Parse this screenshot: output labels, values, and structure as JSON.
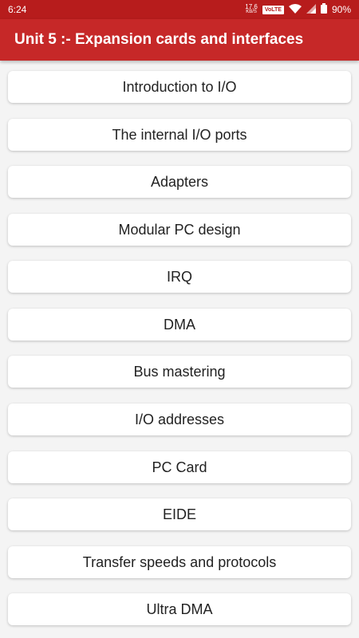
{
  "status_bar": {
    "time": "6:24",
    "net_speed_value": "17.6",
    "net_speed_unit": "KB/S",
    "volte": "VoLTE",
    "battery": "90%"
  },
  "app_bar": {
    "title": "Unit 5 :- Expansion cards and interfaces"
  },
  "topics": [
    "Introduction to I/O",
    "The internal I/O ports",
    "Adapters",
    "Modular PC design",
    "IRQ",
    "DMA",
    "Bus mastering",
    "I/O addresses",
    "PC Card",
    "EIDE",
    "Transfer speeds and protocols",
    "Ultra DMA"
  ],
  "colors": {
    "status_bar": "#b71c1c",
    "app_bar": "#c62828",
    "background": "#f4f4f4",
    "card": "#ffffff"
  }
}
